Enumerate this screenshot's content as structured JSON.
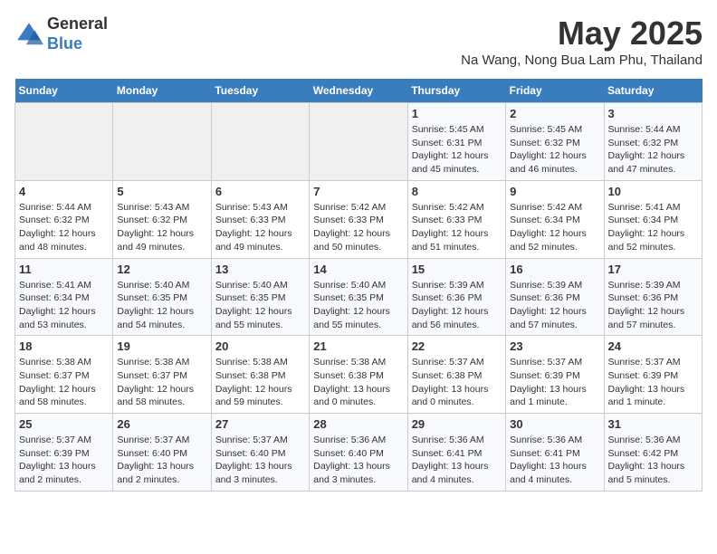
{
  "logo": {
    "general": "General",
    "blue": "Blue"
  },
  "title": "May 2025",
  "location": "Na Wang, Nong Bua Lam Phu, Thailand",
  "days_of_week": [
    "Sunday",
    "Monday",
    "Tuesday",
    "Wednesday",
    "Thursday",
    "Friday",
    "Saturday"
  ],
  "weeks": [
    [
      {
        "day": "",
        "info": ""
      },
      {
        "day": "",
        "info": ""
      },
      {
        "day": "",
        "info": ""
      },
      {
        "day": "",
        "info": ""
      },
      {
        "day": "1",
        "info": "Sunrise: 5:45 AM\nSunset: 6:31 PM\nDaylight: 12 hours\nand 45 minutes."
      },
      {
        "day": "2",
        "info": "Sunrise: 5:45 AM\nSunset: 6:32 PM\nDaylight: 12 hours\nand 46 minutes."
      },
      {
        "day": "3",
        "info": "Sunrise: 5:44 AM\nSunset: 6:32 PM\nDaylight: 12 hours\nand 47 minutes."
      }
    ],
    [
      {
        "day": "4",
        "info": "Sunrise: 5:44 AM\nSunset: 6:32 PM\nDaylight: 12 hours\nand 48 minutes."
      },
      {
        "day": "5",
        "info": "Sunrise: 5:43 AM\nSunset: 6:32 PM\nDaylight: 12 hours\nand 49 minutes."
      },
      {
        "day": "6",
        "info": "Sunrise: 5:43 AM\nSunset: 6:33 PM\nDaylight: 12 hours\nand 49 minutes."
      },
      {
        "day": "7",
        "info": "Sunrise: 5:42 AM\nSunset: 6:33 PM\nDaylight: 12 hours\nand 50 minutes."
      },
      {
        "day": "8",
        "info": "Sunrise: 5:42 AM\nSunset: 6:33 PM\nDaylight: 12 hours\nand 51 minutes."
      },
      {
        "day": "9",
        "info": "Sunrise: 5:42 AM\nSunset: 6:34 PM\nDaylight: 12 hours\nand 52 minutes."
      },
      {
        "day": "10",
        "info": "Sunrise: 5:41 AM\nSunset: 6:34 PM\nDaylight: 12 hours\nand 52 minutes."
      }
    ],
    [
      {
        "day": "11",
        "info": "Sunrise: 5:41 AM\nSunset: 6:34 PM\nDaylight: 12 hours\nand 53 minutes."
      },
      {
        "day": "12",
        "info": "Sunrise: 5:40 AM\nSunset: 6:35 PM\nDaylight: 12 hours\nand 54 minutes."
      },
      {
        "day": "13",
        "info": "Sunrise: 5:40 AM\nSunset: 6:35 PM\nDaylight: 12 hours\nand 55 minutes."
      },
      {
        "day": "14",
        "info": "Sunrise: 5:40 AM\nSunset: 6:35 PM\nDaylight: 12 hours\nand 55 minutes."
      },
      {
        "day": "15",
        "info": "Sunrise: 5:39 AM\nSunset: 6:36 PM\nDaylight: 12 hours\nand 56 minutes."
      },
      {
        "day": "16",
        "info": "Sunrise: 5:39 AM\nSunset: 6:36 PM\nDaylight: 12 hours\nand 57 minutes."
      },
      {
        "day": "17",
        "info": "Sunrise: 5:39 AM\nSunset: 6:36 PM\nDaylight: 12 hours\nand 57 minutes."
      }
    ],
    [
      {
        "day": "18",
        "info": "Sunrise: 5:38 AM\nSunset: 6:37 PM\nDaylight: 12 hours\nand 58 minutes."
      },
      {
        "day": "19",
        "info": "Sunrise: 5:38 AM\nSunset: 6:37 PM\nDaylight: 12 hours\nand 58 minutes."
      },
      {
        "day": "20",
        "info": "Sunrise: 5:38 AM\nSunset: 6:38 PM\nDaylight: 12 hours\nand 59 minutes."
      },
      {
        "day": "21",
        "info": "Sunrise: 5:38 AM\nSunset: 6:38 PM\nDaylight: 13 hours\nand 0 minutes."
      },
      {
        "day": "22",
        "info": "Sunrise: 5:37 AM\nSunset: 6:38 PM\nDaylight: 13 hours\nand 0 minutes."
      },
      {
        "day": "23",
        "info": "Sunrise: 5:37 AM\nSunset: 6:39 PM\nDaylight: 13 hours\nand 1 minute."
      },
      {
        "day": "24",
        "info": "Sunrise: 5:37 AM\nSunset: 6:39 PM\nDaylight: 13 hours\nand 1 minute."
      }
    ],
    [
      {
        "day": "25",
        "info": "Sunrise: 5:37 AM\nSunset: 6:39 PM\nDaylight: 13 hours\nand 2 minutes."
      },
      {
        "day": "26",
        "info": "Sunrise: 5:37 AM\nSunset: 6:40 PM\nDaylight: 13 hours\nand 2 minutes."
      },
      {
        "day": "27",
        "info": "Sunrise: 5:37 AM\nSunset: 6:40 PM\nDaylight: 13 hours\nand 3 minutes."
      },
      {
        "day": "28",
        "info": "Sunrise: 5:36 AM\nSunset: 6:40 PM\nDaylight: 13 hours\nand 3 minutes."
      },
      {
        "day": "29",
        "info": "Sunrise: 5:36 AM\nSunset: 6:41 PM\nDaylight: 13 hours\nand 4 minutes."
      },
      {
        "day": "30",
        "info": "Sunrise: 5:36 AM\nSunset: 6:41 PM\nDaylight: 13 hours\nand 4 minutes."
      },
      {
        "day": "31",
        "info": "Sunrise: 5:36 AM\nSunset: 6:42 PM\nDaylight: 13 hours\nand 5 minutes."
      }
    ]
  ]
}
